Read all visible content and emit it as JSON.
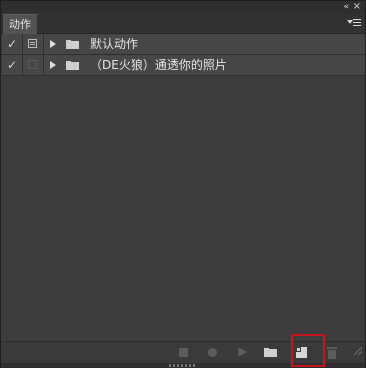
{
  "panel": {
    "tab_label": "动作",
    "collapse_icon": "«",
    "close_icon": "×"
  },
  "actions": [
    {
      "label": "默认动作",
      "enabled": true,
      "dialog_toggle": true,
      "expanded": false
    },
    {
      "label": "（DE火狼）通透你的照片",
      "enabled": true,
      "dialog_toggle": false,
      "expanded": false
    }
  ],
  "toolbar": {
    "buttons": [
      "stop-icon",
      "record-icon",
      "play-icon",
      "new-set-icon",
      "new-action-icon",
      "trash-icon"
    ],
    "highlighted": "new-action-button",
    "highlight_color": "#c4161c"
  },
  "colors": {
    "panel_bg": "#3c3c3c",
    "row_bg": "#474747",
    "text": "#e6e6e6"
  }
}
